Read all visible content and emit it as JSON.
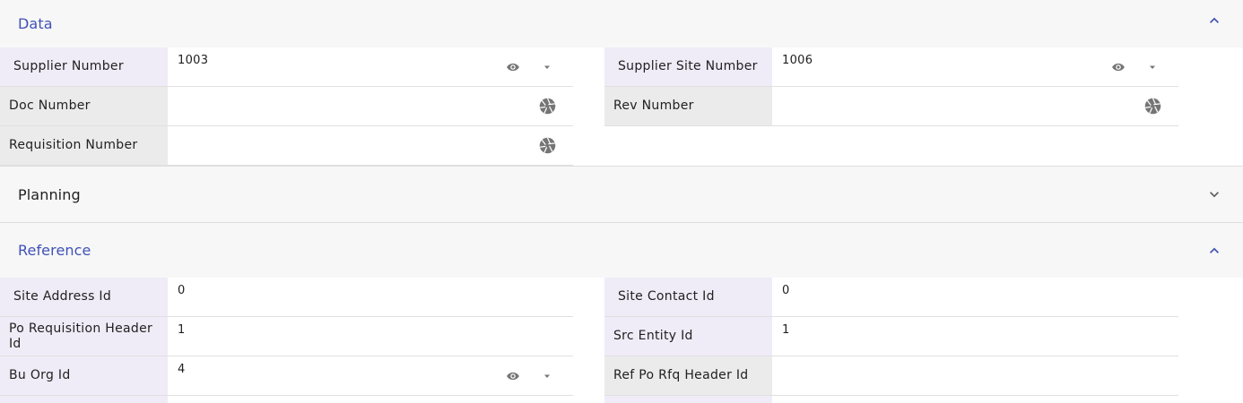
{
  "sections": {
    "data": {
      "title": "Data",
      "fields": {
        "supplier_number": {
          "label": "Supplier Number",
          "value": "1003"
        },
        "supplier_site_number": {
          "label": "Supplier Site Number",
          "value": "1006"
        },
        "doc_number": {
          "label": "Doc Number",
          "value": ""
        },
        "rev_number": {
          "label": "Rev Number",
          "value": ""
        },
        "requisition_number": {
          "label": "Requisition Number",
          "value": ""
        }
      }
    },
    "planning": {
      "title": "Planning"
    },
    "reference": {
      "title": "Reference",
      "fields": {
        "site_address_id": {
          "label": "Site Address Id",
          "value": "0"
        },
        "site_contact_id": {
          "label": "Site Contact Id",
          "value": "0"
        },
        "po_requisition_header_id": {
          "label": "Po Requisition Header Id",
          "value": "1"
        },
        "src_entity_id": {
          "label": "Src Entity Id",
          "value": "1"
        },
        "bu_org_id": {
          "label": "Bu Org Id",
          "value": "4"
        },
        "ref_po_rfq_header_id": {
          "label": "Ref Po Rfq Header Id",
          "value": ""
        }
      }
    }
  },
  "icons": {
    "expanded_chevron": "chevron-up-icon",
    "collapsed_chevron": "chevron-down-icon",
    "view": "eye-icon",
    "dropdown": "dropdown-arrow-icon",
    "generate": "aperture-icon"
  },
  "colors": {
    "accent": "#3f51b5",
    "lov_label_bg": "#efecf7",
    "plain_label_bg": "#ebebeb",
    "header_bg": "#f7f7f7",
    "icon_gray": "#757575"
  }
}
